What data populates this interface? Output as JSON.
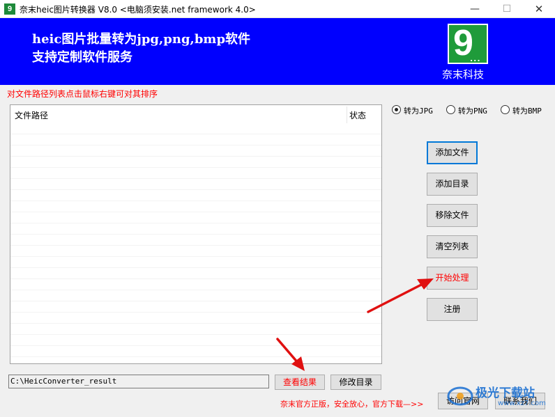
{
  "window": {
    "title": "奈末heic图片转换器 V8.0 <电脑须安装.net framework 4.0>",
    "icon_glyph": "9",
    "minimize_glyph": "—",
    "maximize_glyph": "☐",
    "close_glyph": "✕"
  },
  "banner": {
    "line1": "heic图片批量转为jpg,png,bmp软件",
    "line2": "支持定制软件服务",
    "logo_glyph": "9",
    "logo_dots": "...",
    "logo_text": "奈末科技",
    "background_color": "#0000fe"
  },
  "hint": "对文件路径列表点击鼠标右键可对其排序",
  "list": {
    "columns": [
      "文件路径",
      "状态"
    ],
    "rows": []
  },
  "format_options": [
    {
      "label": "转为JPG",
      "checked": true
    },
    {
      "label": "转为PNG",
      "checked": false
    },
    {
      "label": "转为BMP",
      "checked": false
    }
  ],
  "side_buttons": {
    "add_file": "添加文件",
    "add_dir": "添加目录",
    "remove_file": "移除文件",
    "clear_list": "清空列表",
    "start": "开始处理",
    "register": "注册"
  },
  "output": {
    "path": "C:\\HeicConverter_result",
    "view_result": "查看结果",
    "change_dir": "修改目录"
  },
  "footer": {
    "notice": "奈末官方正版，安全放心，官方下载—>>",
    "visit_site": "访问官网",
    "contact": "联系我们"
  },
  "watermark": {
    "text": "极光下载站",
    "url": "www.xz7.com"
  }
}
